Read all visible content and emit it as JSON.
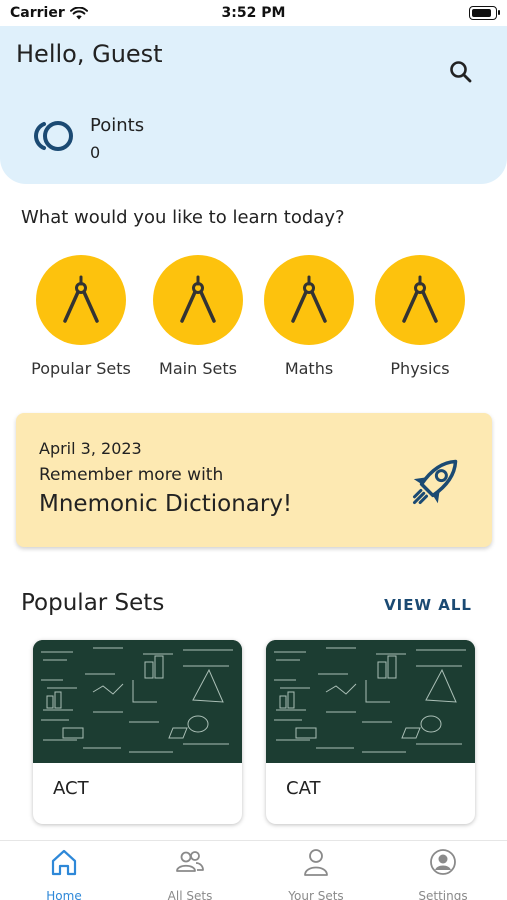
{
  "status_bar": {
    "carrier": "Carrier",
    "time": "3:52 PM",
    "battery_level": 0.9
  },
  "header": {
    "greeting": "Hello, Guest",
    "points_label": "Points",
    "points_value": "0"
  },
  "learn": {
    "title": "What would you like to learn today?",
    "categories": [
      {
        "label": "Popular Sets",
        "icon": "compass-icon"
      },
      {
        "label": "Main Sets",
        "icon": "compass-icon"
      },
      {
        "label": "Maths",
        "icon": "compass-icon"
      },
      {
        "label": "Physics",
        "icon": "compass-icon"
      }
    ]
  },
  "banner": {
    "date": "April 3, 2023",
    "line1": "Remember more with",
    "line2": "Mnemonic Dictionary!",
    "icon": "rocket-icon"
  },
  "popular_sets": {
    "title": "Popular Sets",
    "view_all": "VIEW ALL",
    "cards": [
      {
        "title": "ACT"
      },
      {
        "title": "CAT"
      }
    ]
  },
  "tab_bar": {
    "tabs": [
      {
        "label": "Home",
        "icon": "home-icon",
        "active": true
      },
      {
        "label": "All Sets",
        "icon": "users-icon",
        "active": false
      },
      {
        "label": "Your Sets",
        "icon": "user-icon",
        "active": false
      },
      {
        "label": "Settings",
        "icon": "settings-icon",
        "active": false
      }
    ]
  },
  "colors": {
    "header_bg": "#dff0fb",
    "category_yellow": "#fdc20d",
    "banner_bg": "#fde9b2",
    "link_blue": "#1b4a73",
    "tab_active": "#2e88d8",
    "chalkboard": "#1c3d32"
  }
}
